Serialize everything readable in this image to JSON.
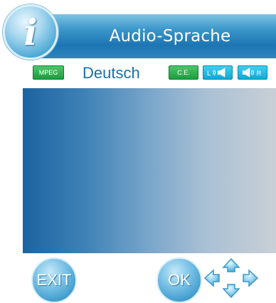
{
  "header": {
    "title": "Audio-Sprache",
    "info_icon": "info-icon",
    "info_glyph": "i"
  },
  "info_row": {
    "codec_badge": "MPEG",
    "language": "Deutsch",
    "ce_badge": "C.E.",
    "left_channel_icon": "speaker-left-icon",
    "right_channel_icon": "speaker-right-icon",
    "left_label": "L",
    "right_label": "R"
  },
  "footer": {
    "exit_label": "EXIT",
    "ok_label": "OK",
    "nav_icon": "directional-arrows-icon"
  },
  "colors": {
    "title_bar": "#1d75b3",
    "language_text": "#1a6ea8",
    "badge_green": "#1f9a3f",
    "badge_cyan": "#0fa9d6",
    "panel_left": "#1c64a0",
    "panel_right": "#c9cfd6"
  }
}
